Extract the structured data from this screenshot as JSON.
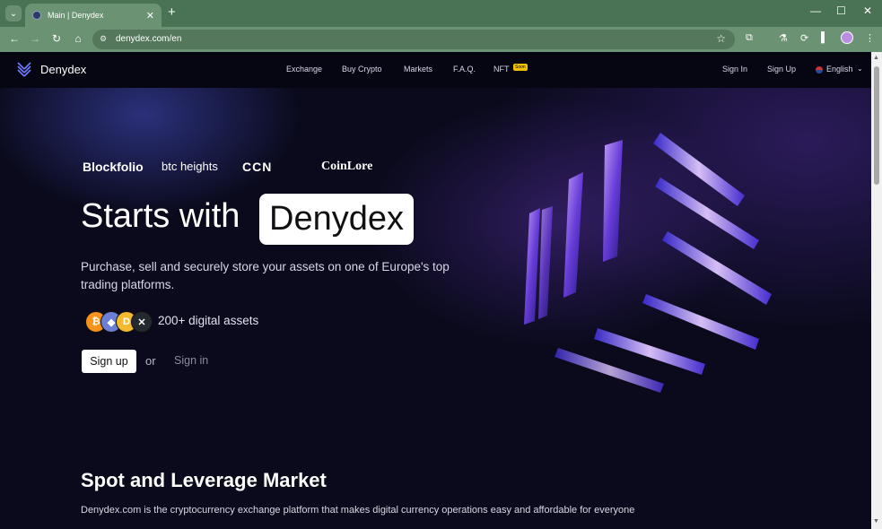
{
  "browser": {
    "tab_title": "Main | Denydex",
    "url": "denydex.com/en"
  },
  "site": {
    "logo_text": "Denydex",
    "nav": [
      "Exchange",
      "Buy Crypto",
      "Markets",
      "F.A.Q.",
      "NFT"
    ],
    "nft_badge": "Soon",
    "sign_in": "Sign In",
    "sign_up": "Sign Up",
    "language": "English"
  },
  "hero": {
    "partners": [
      "Blockfolio",
      "btc heights",
      "CCN",
      "CoinLore"
    ],
    "headline": "Starts with",
    "headline_highlight": "Denydex",
    "subtext": "Purchase, sell and securely store your assets on one of Europe's top trading platforms.",
    "coins": [
      {
        "name": "bitcoin-icon",
        "glyph": "₿",
        "color": "#f7931a"
      },
      {
        "name": "ethereum-icon",
        "glyph": "◆",
        "color": "#6b7fd7"
      },
      {
        "name": "dash-coin-icon",
        "glyph": "D",
        "color": "#f3ba2f"
      },
      {
        "name": "xrp-icon",
        "glyph": "✕",
        "color": "#23292f"
      }
    ],
    "assets_text": "200+ digital assets",
    "signup_label": "Sign up",
    "or_text": "or",
    "signin_label": "Sign in"
  },
  "section": {
    "title": "Spot and Leverage Market",
    "description": "Denydex.com is the cryptocurrency exchange platform that makes digital currency operations easy and affordable for everyone"
  }
}
